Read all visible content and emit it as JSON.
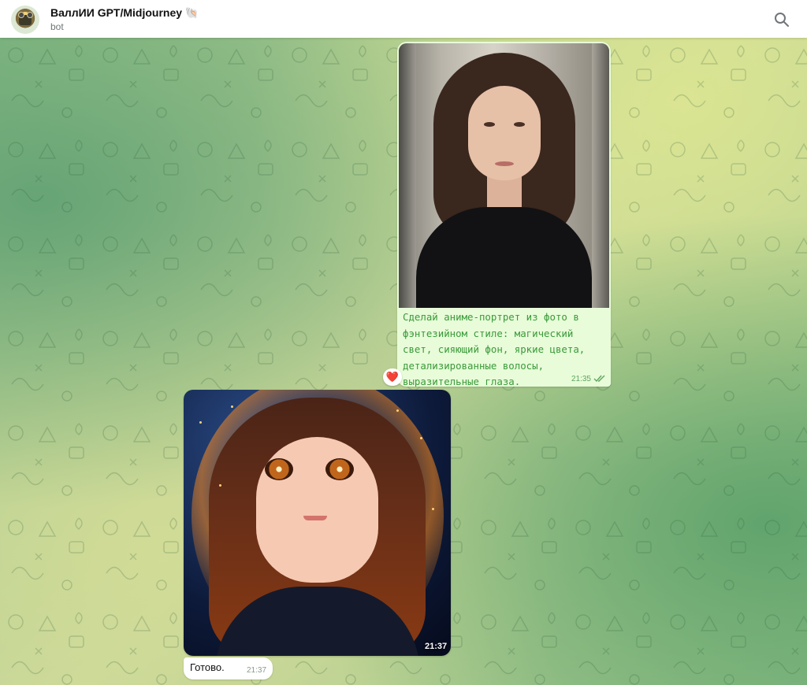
{
  "header": {
    "title": "ВаллИИ GPT/Midjourney 🐚",
    "subtitle": "bot",
    "search_icon": "search-icon",
    "avatar_icon": "robot-avatar"
  },
  "messages": {
    "outgoing": {
      "image_icon": "photo-portrait",
      "caption": "Сделай аниме-портрет из фото в\nфэнтезийном стиле: магический\nсвет, сияющий фон, яркие цвета,\nдетализированные волосы,\nвыразительные глаза.",
      "time": "21:35",
      "status_icon": "double-check-icon",
      "reaction": "❤️"
    },
    "incoming": {
      "image_icon": "anime-portrait",
      "image_time": "21:37",
      "text": "Готово.",
      "time": "21:37"
    }
  },
  "colors": {
    "header_bg": "#ffffff",
    "outgoing_bubble": "#e8fcd9",
    "caption_text": "#3a9a3a",
    "incoming_bubble": "#ffffff",
    "reaction_heart": "#e0213a"
  }
}
